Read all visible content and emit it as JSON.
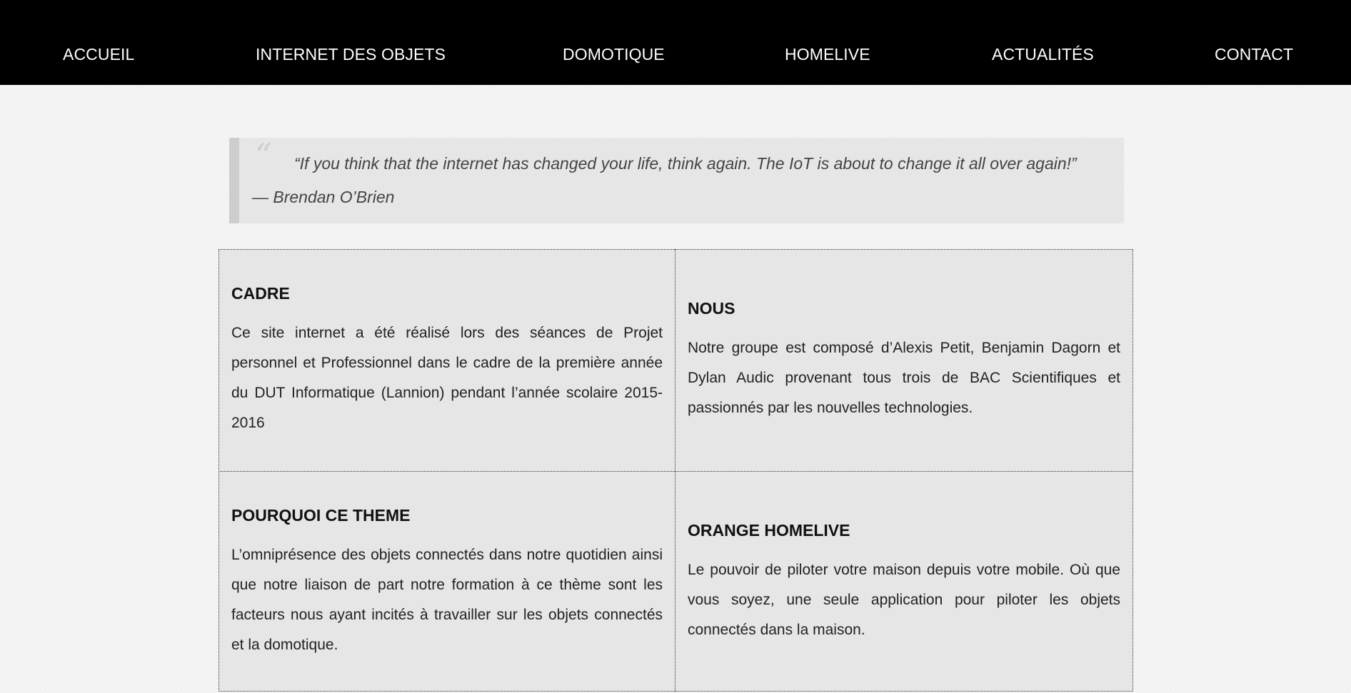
{
  "nav": {
    "items": [
      {
        "label": "ACCUEIL"
      },
      {
        "label": "INTERNET DES OBJETS"
      },
      {
        "label": "DOMOTIQUE"
      },
      {
        "label": "HOMELIVE"
      },
      {
        "label": "ACTUALITÉS"
      },
      {
        "label": "CONTACT"
      }
    ]
  },
  "quote": {
    "mark": "“",
    "text": "“If you think that the internet has changed your life, think again. The IoT is about to change it all over again!”",
    "author": "— Brendan O’Brien"
  },
  "sections": [
    {
      "title": "CADRE",
      "text": "Ce site internet a été réalisé lors des séances de Projet personnel et Professionnel dans le cadre de la première année du DUT Informatique (Lannion) pendant l’année scolaire 2015-2016"
    },
    {
      "title": "NOUS",
      "text": "Notre groupe est composé d’Alexis Petit, Benjamin Dagorn et Dylan Audic provenant tous trois de BAC Scientifiques et passionnés par les nouvelles technologies."
    },
    {
      "title": "POURQUOI CE THEME",
      "text": "L’omniprésence des objets connectés dans notre quotidien ainsi que notre liaison de part notre formation à ce thème sont les facteurs nous ayant incités à travailler sur les objets connectés et la domotique."
    },
    {
      "title": "ORANGE HOMELIVE",
      "text": "Le pouvoir de piloter votre maison depuis votre mobile. Où que vous soyez, une seule application pour piloter les objets connectés dans la maison."
    }
  ]
}
